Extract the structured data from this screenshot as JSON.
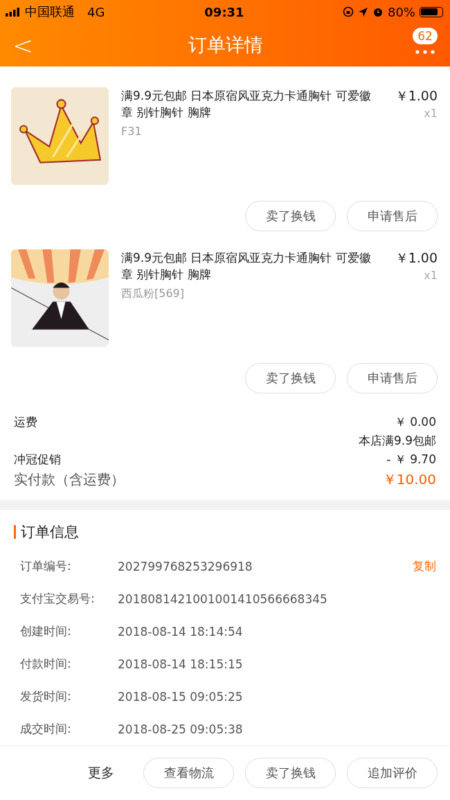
{
  "status_bar": {
    "carrier": "中国联通",
    "network": "4G",
    "time": "09:31",
    "battery": "80%"
  },
  "nav": {
    "back": "<",
    "title": "订单详情",
    "badge": "62"
  },
  "items": [
    {
      "kind": "crown",
      "title": "满9.9元包邮 日本原宿风亚克力卡通胸针 可爱徽章 别针胸针 胸牌",
      "sku": "F31",
      "price": "￥1.00",
      "qty": "x1",
      "buttons": [
        "卖了换钱",
        "申请售后"
      ]
    },
    {
      "kind": "figure",
      "title": "满9.9元包邮 日本原宿风亚克力卡通胸针 可爱徽章 别针胸针 胸牌",
      "sku": "西瓜粉[569]",
      "price": "￥1.00",
      "qty": "x1",
      "buttons": [
        "卖了换钱",
        "申请售后"
      ]
    }
  ],
  "summary": [
    {
      "kind": "line",
      "label": "运费",
      "value": "￥ 0.00",
      "note": "本店满9.9包邮"
    },
    {
      "kind": "line",
      "label": "冲冠促销",
      "value": "- ￥ 9.70"
    },
    {
      "kind": "total",
      "label": "实付款（含运费）",
      "value": "￥10.00"
    }
  ],
  "order_info": {
    "title": "订单信息",
    "rows": [
      {
        "label": "订单编号:",
        "value": "202799768253296918",
        "action": "复制"
      },
      {
        "label": "支付宝交易号:",
        "value": "2018081421001001410566668345"
      },
      {
        "label": "创建时间:",
        "value": "2018-08-14 18:14:54"
      },
      {
        "label": "付款时间:",
        "value": "2018-08-14 18:15:15"
      },
      {
        "label": "发货时间:",
        "value": "2018-08-15 09:05:25"
      },
      {
        "label": "成交时间:",
        "value": "2018-08-25 09:05:38"
      }
    ]
  },
  "bottom_bar": {
    "more": "更多",
    "buttons": [
      "查看物流",
      "卖了换钱",
      "追加评价"
    ]
  }
}
